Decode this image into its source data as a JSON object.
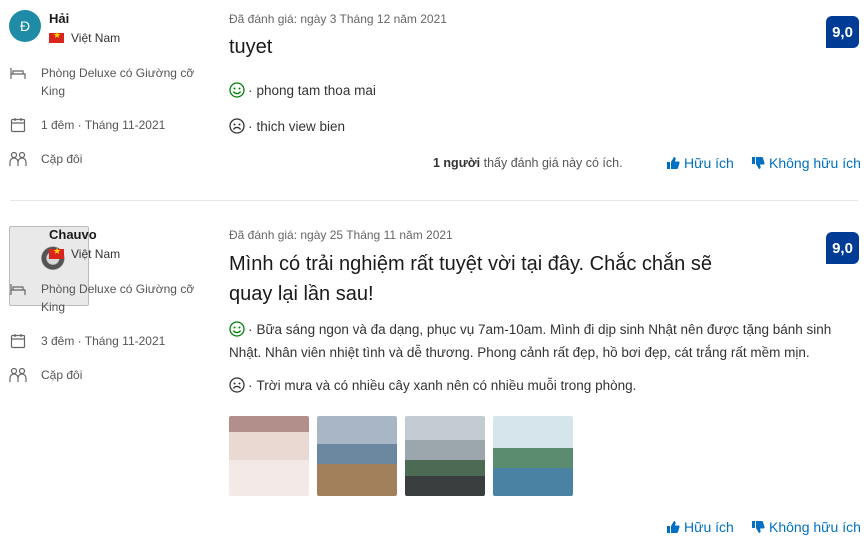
{
  "colors": {
    "score_bg": "#003b95",
    "link": "#0071c2",
    "pro_face": "#008009",
    "con_face": "#1a1a1a"
  },
  "reviews": [
    {
      "avatar_initial": "Đ",
      "name": "Hải",
      "country": "Việt Nam",
      "room": "Phòng Deluxe có Giường cỡ King",
      "stay": "1 đêm · Tháng 11-2021",
      "traveler": "Cặp đôi",
      "date": "Đã đánh giá: ngày 3 Tháng 12 năm 2021",
      "title": "tuyet",
      "score": "9,0",
      "pro": "phong tam thoa mai",
      "con": "thich view bien",
      "helpful_count": "1 người",
      "helpful_text": "thấy đánh giá này có ích.",
      "helpful_label": "Hữu ích",
      "unhelpful_label": "Không hữu ích"
    },
    {
      "name": "Chauvo",
      "country": "Việt Nam",
      "room": "Phòng Deluxe có Giường cỡ King",
      "stay": "3 đêm · Tháng 11-2021",
      "traveler": "Cặp đôi",
      "date": "Đã đánh giá: ngày 25 Tháng 11 năm 2021",
      "title": "Mình có trải nghiệm rất tuyệt vời tại đây. Chắc chắn sẽ quay lại lần sau!",
      "score": "9,0",
      "pro": "Bữa sáng ngon và đa dạng, phục vụ 7am-10am. Mình đi dịp sinh Nhật nên được tặng bánh sinh Nhật. Nhân viên nhiệt tình và dễ thương. Phong cảnh rất đẹp, hồ bơi đẹp, cát trắng rất mềm mịn.",
      "con": "Trời mưa và có nhiều cây xanh nên có nhiều muỗi trong phòng.",
      "helpful_label": "Hữu ích",
      "unhelpful_label": "Không hữu ích"
    }
  ]
}
